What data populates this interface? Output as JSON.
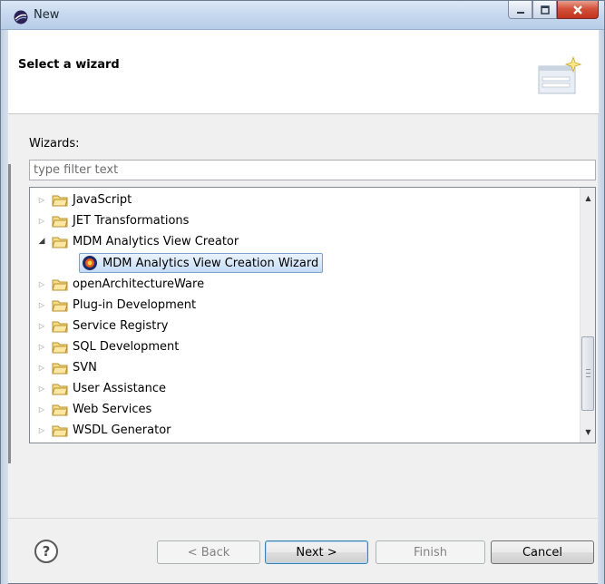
{
  "window": {
    "title": "New",
    "controls": [
      "minimize",
      "maximize",
      "close"
    ]
  },
  "banner": {
    "title": "Select a wizard"
  },
  "wizards_label": "Wizards:",
  "filter": {
    "placeholder": "type filter text",
    "value": ""
  },
  "tree": {
    "items": [
      {
        "label": "JavaScript",
        "expanded": false
      },
      {
        "label": "JET Transformations",
        "expanded": false
      },
      {
        "label": "MDM Analytics View Creator",
        "expanded": true
      },
      {
        "label": "MDM Analytics View Creation Wizard",
        "selected": true
      },
      {
        "label": "openArchitectureWare",
        "expanded": false
      },
      {
        "label": "Plug-in Development",
        "expanded": false
      },
      {
        "label": "Service Registry",
        "expanded": false
      },
      {
        "label": "SQL Development",
        "expanded": false
      },
      {
        "label": "SVN",
        "expanded": false
      },
      {
        "label": "User Assistance",
        "expanded": false
      },
      {
        "label": "Web Services",
        "expanded": false
      },
      {
        "label": "WSDL Generator",
        "expanded": false
      }
    ]
  },
  "footer": {
    "help": "?",
    "back": "< Back",
    "next": "Next >",
    "finish": "Finish",
    "cancel": "Cancel"
  },
  "icons": {
    "app": "eclipse-icon",
    "folder": "folder-icon",
    "wizard": "wizard-icon",
    "banner": "new-wizard-banner-icon"
  },
  "colors": {
    "selection_bg": "#c5dcf6",
    "selection_border": "#7da2ce",
    "close_button": "#c2321c"
  }
}
